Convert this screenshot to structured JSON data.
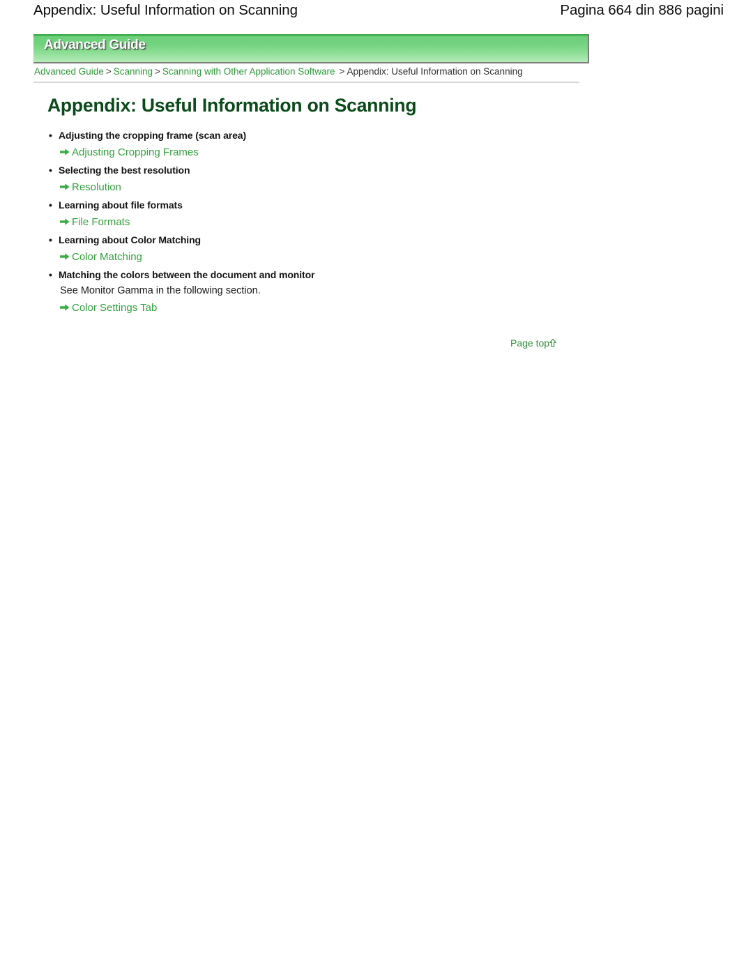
{
  "page_header": {
    "title": "Appendix: Useful Information on Scanning",
    "page_count": "Pagina 664 din 886 pagini"
  },
  "banner": {
    "label": "Advanced Guide",
    "gradient_top_color": "#3cab4b",
    "gradient_bottom_color": "#bdeec0"
  },
  "breadcrumb": {
    "items": [
      {
        "label": "Advanced Guide",
        "is_link": true
      },
      {
        "label": "Scanning",
        "is_link": true
      },
      {
        "label": "Scanning with Other Application Software",
        "is_link": true
      },
      {
        "label": "Appendix: Useful Information on Scanning",
        "is_link": false
      }
    ],
    "separator": ">"
  },
  "main": {
    "title": "Appendix: Useful Information on Scanning",
    "title_color": "#0b4a1a",
    "link_color": "#33a13c",
    "topics": [
      {
        "heading": "Adjusting the cropping frame (scan area)",
        "note": null,
        "link": "Adjusting Cropping Frames"
      },
      {
        "heading": "Selecting the best resolution",
        "note": null,
        "link": "Resolution"
      },
      {
        "heading": "Learning about file formats",
        "note": null,
        "link": "File Formats"
      },
      {
        "heading": "Learning about Color Matching",
        "note": null,
        "link": "Color Matching"
      },
      {
        "heading": "Matching the colors between the document and monitor",
        "note": "See Monitor Gamma in the following section.",
        "link": "Color Settings Tab"
      }
    ],
    "bullet_glyph": "•",
    "arrow_icon": "right-arrow-icon"
  },
  "page_top": {
    "label": "Page top",
    "icon": "up-arrow-icon"
  }
}
